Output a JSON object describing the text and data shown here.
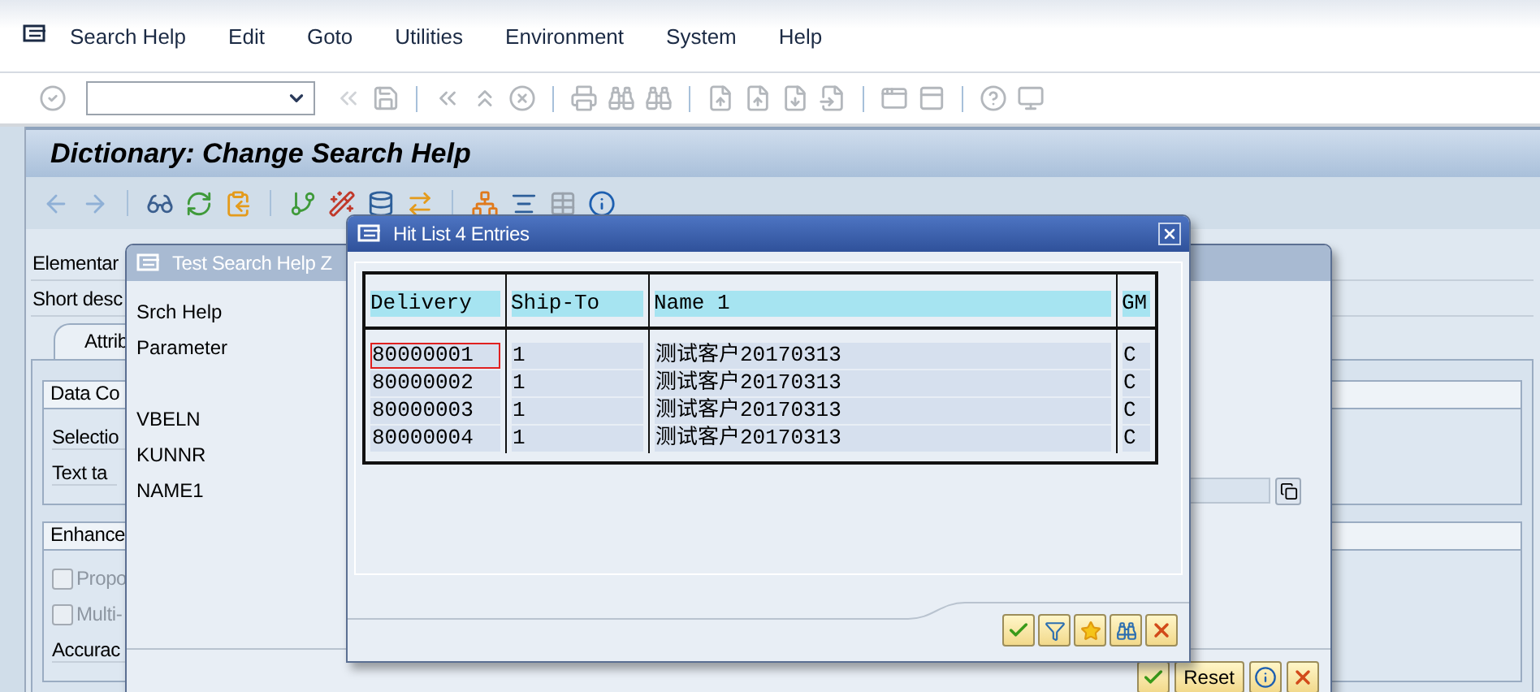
{
  "menu_bar": {
    "items": [
      "Search Help",
      "Edit",
      "Goto",
      "Utilities",
      "Environment",
      "System",
      "Help"
    ]
  },
  "screen_title": "Dictionary: Change Search Help",
  "main_form": {
    "labels": [
      "Elementar",
      "Short desc"
    ],
    "tab": "Attrib",
    "groups": [
      {
        "title": "Data Co",
        "rows": [
          {
            "kind": "label",
            "label": "Selectio"
          },
          {
            "kind": "label",
            "label": "Text ta"
          }
        ]
      },
      {
        "title": "Enhance",
        "rows": [
          {
            "kind": "checkbox",
            "label": "Propo",
            "checked": false,
            "disabled": true
          },
          {
            "kind": "checkbox",
            "label": "Multi-",
            "checked": false,
            "disabled": true
          },
          {
            "kind": "label",
            "label": "Accurac"
          }
        ]
      }
    ]
  },
  "test_dialog": {
    "title": "Test Search Help Z",
    "labels": [
      "Srch Help",
      "Parameter"
    ],
    "parameters": [
      {
        "name": "VBELN",
        "has_input": false
      },
      {
        "name": "KUNNR",
        "has_input": false
      },
      {
        "name": "NAME1",
        "has_input": true
      }
    ],
    "buttons": [
      "Reset"
    ]
  },
  "hit_list": {
    "title": "Hit List 4 Entries",
    "columns": [
      "Delivery",
      "Ship-To",
      "Name 1",
      "GM"
    ],
    "rows": [
      {
        "cells": [
          "80000001",
          "1",
          "测试客户20170313",
          "C"
        ],
        "focused": true
      },
      {
        "cells": [
          "80000002",
          "1",
          "测试客户20170313",
          "C"
        ],
        "focused": false
      },
      {
        "cells": [
          "80000003",
          "1",
          "测试客户20170313",
          "C"
        ],
        "focused": false
      },
      {
        "cells": [
          "80000004",
          "1",
          "测试客户20170313",
          "C"
        ],
        "focused": false
      }
    ]
  }
}
